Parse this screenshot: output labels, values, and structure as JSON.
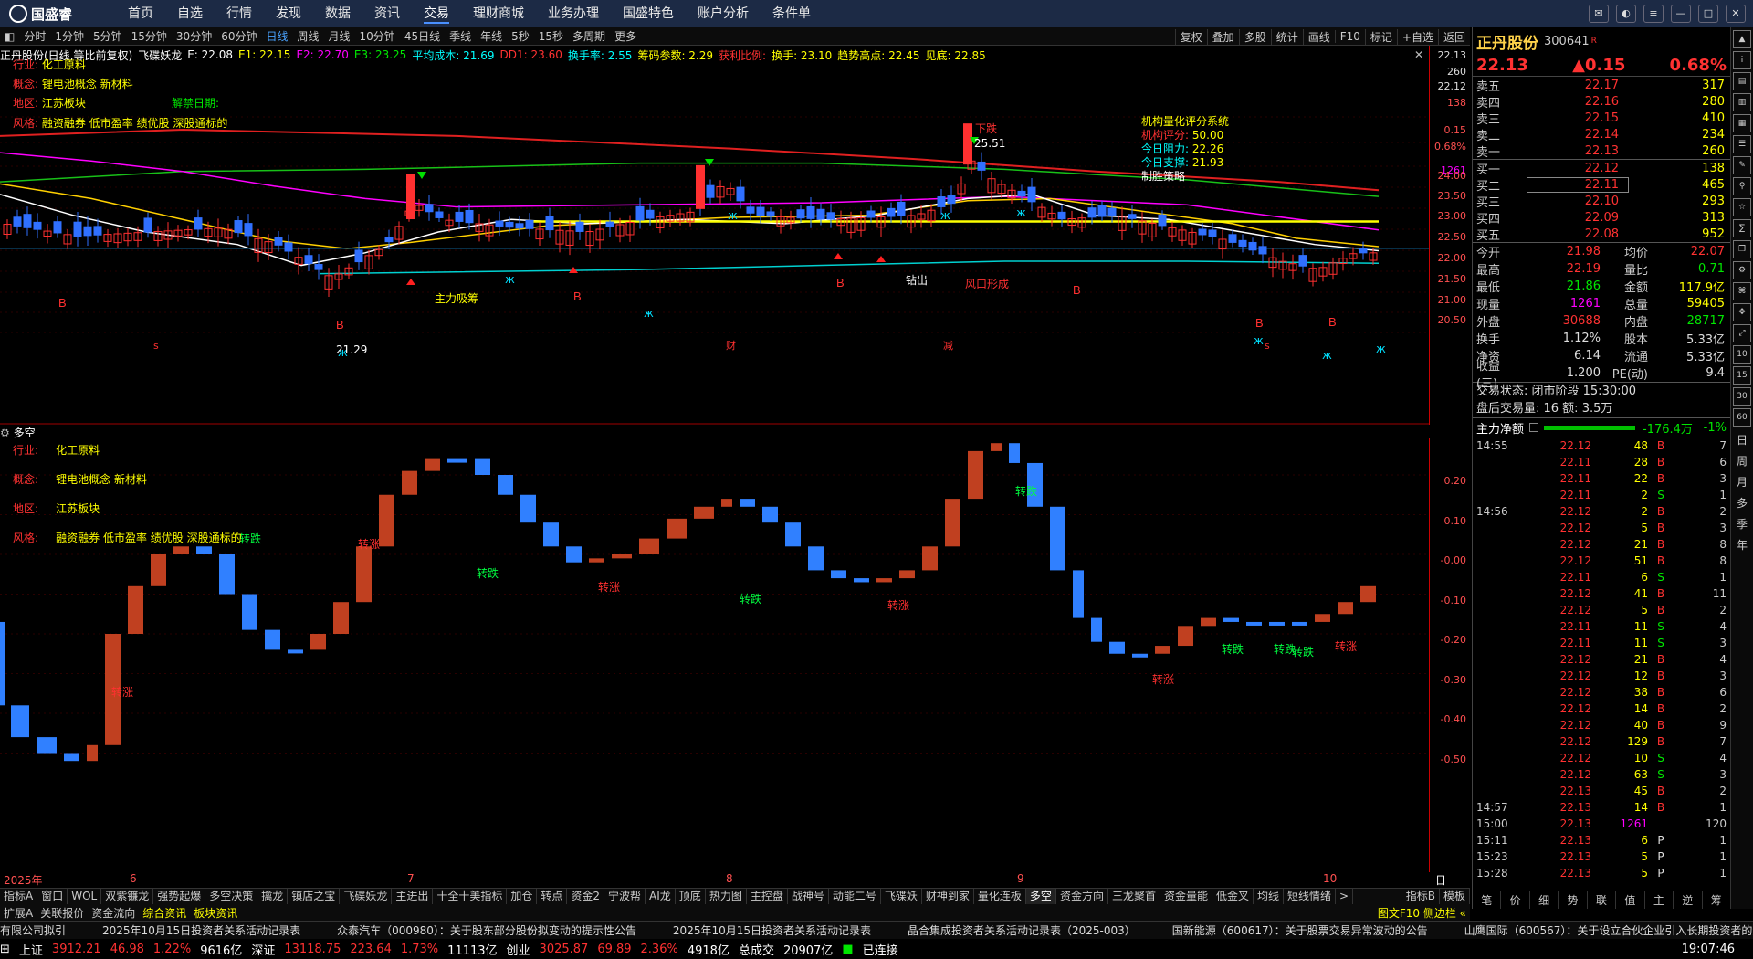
{
  "menubar": {
    "brand": "国盛睿",
    "items": [
      "首页",
      "自选",
      "行情",
      "发现",
      "数据",
      "资讯",
      "交易",
      "理财商城",
      "业务办理",
      "国盛特色",
      "账户分析",
      "条件单"
    ],
    "active_index": 6
  },
  "periodbar": {
    "items": [
      "分时",
      "1分钟",
      "5分钟",
      "15分钟",
      "30分钟",
      "60分钟",
      "日线",
      "周线",
      "月线",
      "10分钟",
      "45日线",
      "季线",
      "年线",
      "5秒",
      "15秒",
      "多周期",
      "更多"
    ],
    "active_index": 6,
    "tools": [
      "复权",
      "叠加",
      "多股",
      "统计",
      "画线",
      "F10",
      "标记",
      "+自选",
      "返回"
    ]
  },
  "indhead": {
    "stock": "正丹股份(日线,等比前复权)",
    "formula": "飞碟妖龙",
    "e": "E: 22.08",
    "e1": "E1: 22.15",
    "e2": "E2: 22.70",
    "e3": "E3: 23.25",
    "avg": "平均成本: 21.69",
    "dd1": "DD1: 23.60",
    "turn": "换手率: 2.55",
    "chip": "筹码参数: 2.29",
    "profit": "获利比例:",
    "hand": "换手: 23.10",
    "high": "趋势高点: 22.45",
    "low": "见底: 22.85"
  },
  "main_info": {
    "industry_label": "行业:",
    "industry": "化工原料",
    "concept_label": "概念:",
    "concept": "锂电池概念 新材料",
    "region_label": "地区:",
    "region": "江苏板块",
    "unlock_label": "解禁日期:",
    "style_label": "风格:",
    "style": "融资融券 低市盈率 绩优股 深股通标的"
  },
  "score": {
    "title": "机构量化评分系统",
    "l1": "机构评分:",
    "v1": "50.00",
    "l2": "今日阻力:",
    "v2": "22.26",
    "l3": "今日支撑:",
    "v3": "21.93",
    "verdict": "制胜策略"
  },
  "annotations": {
    "xiadie": "下跌",
    "peak": "25.51",
    "trough": "21.29",
    "zhuli": "主力吸筹",
    "fengkou": "风口形成",
    "zhichu": "钻出",
    "b": "B"
  },
  "main_axis": [
    "22.13",
    "260",
    "22.12",
    "138",
    "0.15",
    "0.68%",
    "1261",
    "24.00",
    "23.50",
    "23.00",
    "22.50",
    "22.00",
    "21.50",
    "21.00",
    "20.50"
  ],
  "sub_axis": [
    "0.20",
    "0.10",
    "-0.00",
    "-0.10",
    "-0.20",
    "-0.30",
    "-0.40",
    "-0.50"
  ],
  "sub_title": "多空",
  "sub_labels": {
    "zhuan_die": "转跌",
    "zhuan_zhang": "转涨"
  },
  "dates": {
    "year": "2025年",
    "m6": "6",
    "m7": "7",
    "m8": "8",
    "m9": "9",
    "m10": "10",
    "period": "日线"
  },
  "markers": {
    "s": "s",
    "cai": "财",
    "jian": "减"
  },
  "indtabs": [
    "指标A",
    "窗口",
    "WOL",
    "双紫镰龙",
    "强势起爆",
    "多空决策",
    "擒龙",
    "镇店之宝",
    "飞碟妖龙",
    "主进出",
    "十全十美指标",
    "加仓",
    "转点",
    "资金2",
    "宁波帮",
    "AI龙",
    "顶底",
    "热力图",
    "主控盘",
    "战神号",
    "动能二号",
    "飞碟妖",
    "财神到家",
    "量化连板",
    "多空",
    "资金方向",
    "三龙聚首",
    "资金量能",
    "低金叉",
    "均线",
    "短线情绪"
  ],
  "indtabs_active": 24,
  "indtabs_right": [
    "指标B",
    "模板"
  ],
  "navbar": [
    "扩展A",
    "关联报价",
    "资金流向",
    "综合资讯",
    "板块资讯"
  ],
  "navbar_right": "图文F10 侧边栏 «",
  "news": [
    "有限公司拟引",
    "2025年10月15日投资者关系活动记录表",
    "众泰汽车（000980）：关于股东部分股份拟变动的提示性公告",
    "2025年10月15日投资者关系活动记录表",
    "晶合集成投资者关系活动记录表（2025-003）",
    "国新能源（600617）：关于股票交易异常波动的公告",
    "山鹰国际（600567）：关于设立合伙企业引入长期投资者的进展"
  ],
  "status": {
    "sh_label": "上证",
    "sh": "3912.21",
    "sh_chg": "46.98",
    "sh_pct": "1.22%",
    "sh_amt": "9616亿",
    "sz_label": "深证",
    "sz": "13118.75",
    "sz_chg": "223.64",
    "sz_pct": "1.73%",
    "sz_amt": "11113亿",
    "cy_label": "创业",
    "cy": "3025.87",
    "cy_chg": "69.89",
    "cy_pct": "2.36%",
    "cy_amt": "4918亿",
    "total_label": "总成交",
    "total": "20907亿",
    "conn": "已连接",
    "time": "19:07:46"
  },
  "quote": {
    "name": "正丹股份",
    "code": "300641",
    "badge": "R",
    "price": "22.13",
    "chg": "▲0.15",
    "pct": "0.68%",
    "asks": [
      {
        "l": "卖五",
        "p": "22.17",
        "v": "317"
      },
      {
        "l": "卖四",
        "p": "22.16",
        "v": "280"
      },
      {
        "l": "卖三",
        "p": "22.15",
        "v": "410"
      },
      {
        "l": "卖二",
        "p": "22.14",
        "v": "234"
      },
      {
        "l": "卖一",
        "p": "22.13",
        "v": "260"
      }
    ],
    "bids": [
      {
        "l": "买一",
        "p": "22.12",
        "v": "138"
      },
      {
        "l": "买二",
        "p": "22.11",
        "v": "465"
      },
      {
        "l": "买三",
        "p": "22.10",
        "v": "293"
      },
      {
        "l": "买四",
        "p": "22.09",
        "v": "313"
      },
      {
        "l": "买五",
        "p": "22.08",
        "v": "952"
      }
    ],
    "stats": [
      [
        "今开",
        "21.98",
        "均价",
        "22.07"
      ],
      [
        "最高",
        "22.19",
        "量比",
        "0.71"
      ],
      [
        "最低",
        "21.86",
        "金额",
        "117.9亿"
      ],
      [
        "现量",
        "1261",
        "总量",
        "59405"
      ],
      [
        "外盘",
        "30688",
        "内盘",
        "28717"
      ],
      [
        "换手",
        "1.12%",
        "股本",
        "5.33亿"
      ],
      [
        "净资",
        "6.14",
        "流通",
        "5.33亿"
      ],
      [
        "收益(三)",
        "1.200",
        "PE(动)",
        "9.4"
      ]
    ],
    "trade_state": "交易状态: 闭市阶段 15:30:00",
    "after": "盘后交易量: 16  额: 3.5万",
    "mainflow_label": "主力净额",
    "mainflow": "-176.4万",
    "mainflow_pct": "-1%",
    "ticks": [
      [
        "14:55",
        "22.12",
        "48",
        "B",
        "7"
      ],
      [
        "",
        "22.11",
        "28",
        "B",
        "6"
      ],
      [
        "",
        "22.11",
        "22",
        "B",
        "3"
      ],
      [
        "",
        "22.11",
        "2",
        "S",
        "1"
      ],
      [
        "14:56",
        "22.12",
        "2",
        "B",
        "2"
      ],
      [
        "",
        "22.12",
        "5",
        "B",
        "3"
      ],
      [
        "",
        "22.12",
        "21",
        "B",
        "8"
      ],
      [
        "",
        "22.12",
        "51",
        "B",
        "8"
      ],
      [
        "",
        "22.11",
        "6",
        "S",
        "1"
      ],
      [
        "",
        "22.12",
        "41",
        "B",
        "11"
      ],
      [
        "",
        "22.12",
        "5",
        "B",
        "2"
      ],
      [
        "",
        "22.11",
        "11",
        "S",
        "4"
      ],
      [
        "",
        "22.11",
        "11",
        "S",
        "3"
      ],
      [
        "",
        "22.12",
        "21",
        "B",
        "4"
      ],
      [
        "",
        "22.12",
        "12",
        "B",
        "3"
      ],
      [
        "",
        "22.12",
        "38",
        "B",
        "6"
      ],
      [
        "",
        "22.12",
        "14",
        "B",
        "2"
      ],
      [
        "",
        "22.12",
        "40",
        "B",
        "9"
      ],
      [
        "",
        "22.12",
        "129",
        "B",
        "7"
      ],
      [
        "",
        "22.12",
        "10",
        "S",
        "4"
      ],
      [
        "",
        "22.12",
        "63",
        "S",
        "3"
      ],
      [
        "",
        "22.13",
        "45",
        "B",
        "2"
      ],
      [
        "14:57",
        "22.13",
        "14",
        "B",
        "1"
      ],
      [
        "15:00",
        "22.13",
        "1261",
        "",
        "120"
      ],
      [
        "15:11",
        "22.13",
        "6",
        "P",
        "1"
      ],
      [
        "15:23",
        "22.13",
        "5",
        "P",
        "1"
      ],
      [
        "15:28",
        "22.13",
        "5",
        "P",
        "1"
      ]
    ],
    "tabs": [
      "笔",
      "价",
      "细",
      "势",
      "联",
      "值",
      "主",
      "逆",
      "筹"
    ]
  },
  "sidebar": [
    "日",
    "周",
    "月",
    "多",
    "季",
    "年"
  ]
}
